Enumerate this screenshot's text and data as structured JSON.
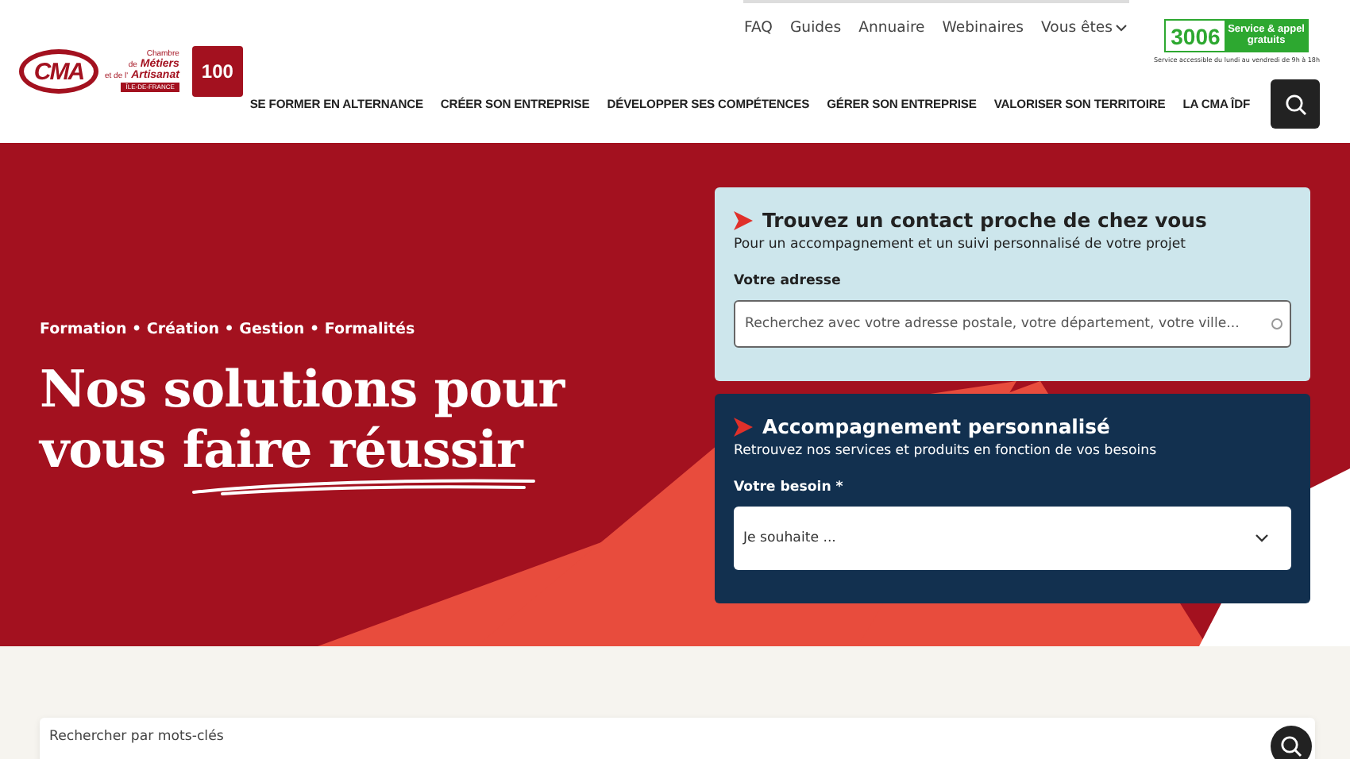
{
  "logo": {
    "initials": "CMA",
    "line_1": "Chambre",
    "line_2_prefix": "de",
    "line_2": "Métiers",
    "line_3_prefix": "et de l'",
    "line_3": "Artisanat",
    "region": "ÎLE-DE-FRANCE",
    "anniversary": "100"
  },
  "top_links": [
    {
      "label": "FAQ",
      "kind": "link"
    },
    {
      "label": "Guides",
      "kind": "link"
    },
    {
      "label": "Annuaire",
      "kind": "link"
    },
    {
      "label": "Webinaires",
      "kind": "link"
    },
    {
      "label": "Vous êtes",
      "kind": "dropdown"
    }
  ],
  "phone_badge": {
    "number": "3006",
    "label": "Service & appel gratuits",
    "note": "Service accessible du lundi au vendredi de 9h à 18h"
  },
  "main_nav": [
    "SE FORMER EN ALTERNANCE",
    "CRÉER SON ENTREPRISE",
    "DÉVELOPPER SES COMPÉTENCES",
    "GÉRER SON ENTREPRISE",
    "VALORISER SON TERRITOIRE",
    "LA CMA ÎDF"
  ],
  "hero": {
    "tagline": "Formation • Création • Gestion • Formalités",
    "heading": "Nos solutions pour vous faire réussir"
  },
  "cards": [
    {
      "kind": "search",
      "title": "Trouvez un contact proche de chez vous",
      "subtitle": "Pour un accompagnement et un suivi personnalisé de votre projet",
      "field_label": "Votre adresse",
      "placeholder": "Recherchez avec votre adresse postale, votre département, votre ville..."
    },
    {
      "kind": "select",
      "title": "Accompagnement personnalisé",
      "subtitle": "Retrouvez nos services et produits en fonction de vos besoins",
      "field_label": "Votre besoin *",
      "placeholder": "Je souhaite ..."
    }
  ],
  "keyword_search": {
    "placeholder": "Rechercher par mots-clés"
  }
}
